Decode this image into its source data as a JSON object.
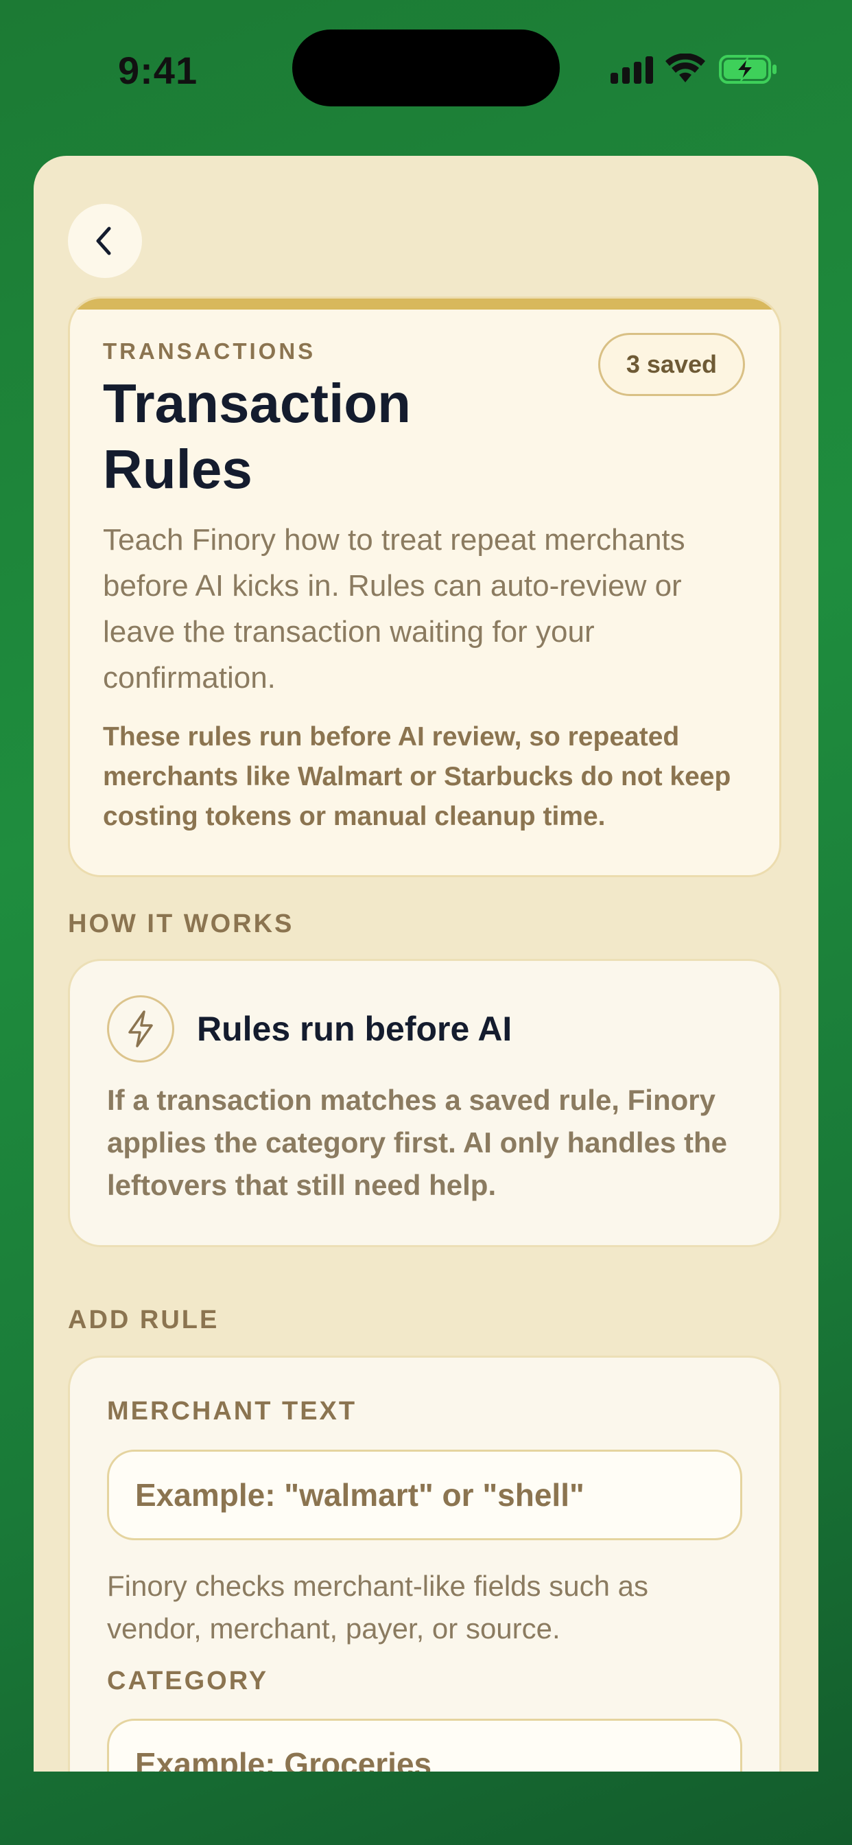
{
  "status_bar": {
    "time": "9:41"
  },
  "hero": {
    "eyebrow": "TRANSACTIONS",
    "title": "Transaction Rules",
    "badge": "3 saved",
    "description": "Teach Finory how to treat repeat merchants before AI kicks in. Rules can auto-review or leave the transaction waiting for your confirmation.",
    "note": "These rules run before AI review, so repeated merchants like Walmart or Starbucks do not keep costing tokens or manual cleanup time."
  },
  "how_it_works": {
    "section_label": "HOW IT WORKS",
    "icon": "lightning-icon",
    "title": "Rules run before AI",
    "body": "If a transaction matches a saved rule, Finory applies the category first. AI only handles the leftovers that still need help."
  },
  "add_rule": {
    "section_label": "ADD RULE",
    "merchant_label": "MERCHANT TEXT",
    "merchant_placeholder": "Example: \"walmart\" or \"shell\"",
    "merchant_help": "Finory checks merchant-like fields such as vendor, merchant, payer, or source.",
    "category_label": "CATEGORY",
    "category_placeholder": "Example: Groceries"
  },
  "colors": {
    "background": "#1f8d3e",
    "sheet": "#f2e8c9",
    "accent_gold": "#d8b85c",
    "title_ink": "#141c2e",
    "label_brown": "#8b7450"
  }
}
